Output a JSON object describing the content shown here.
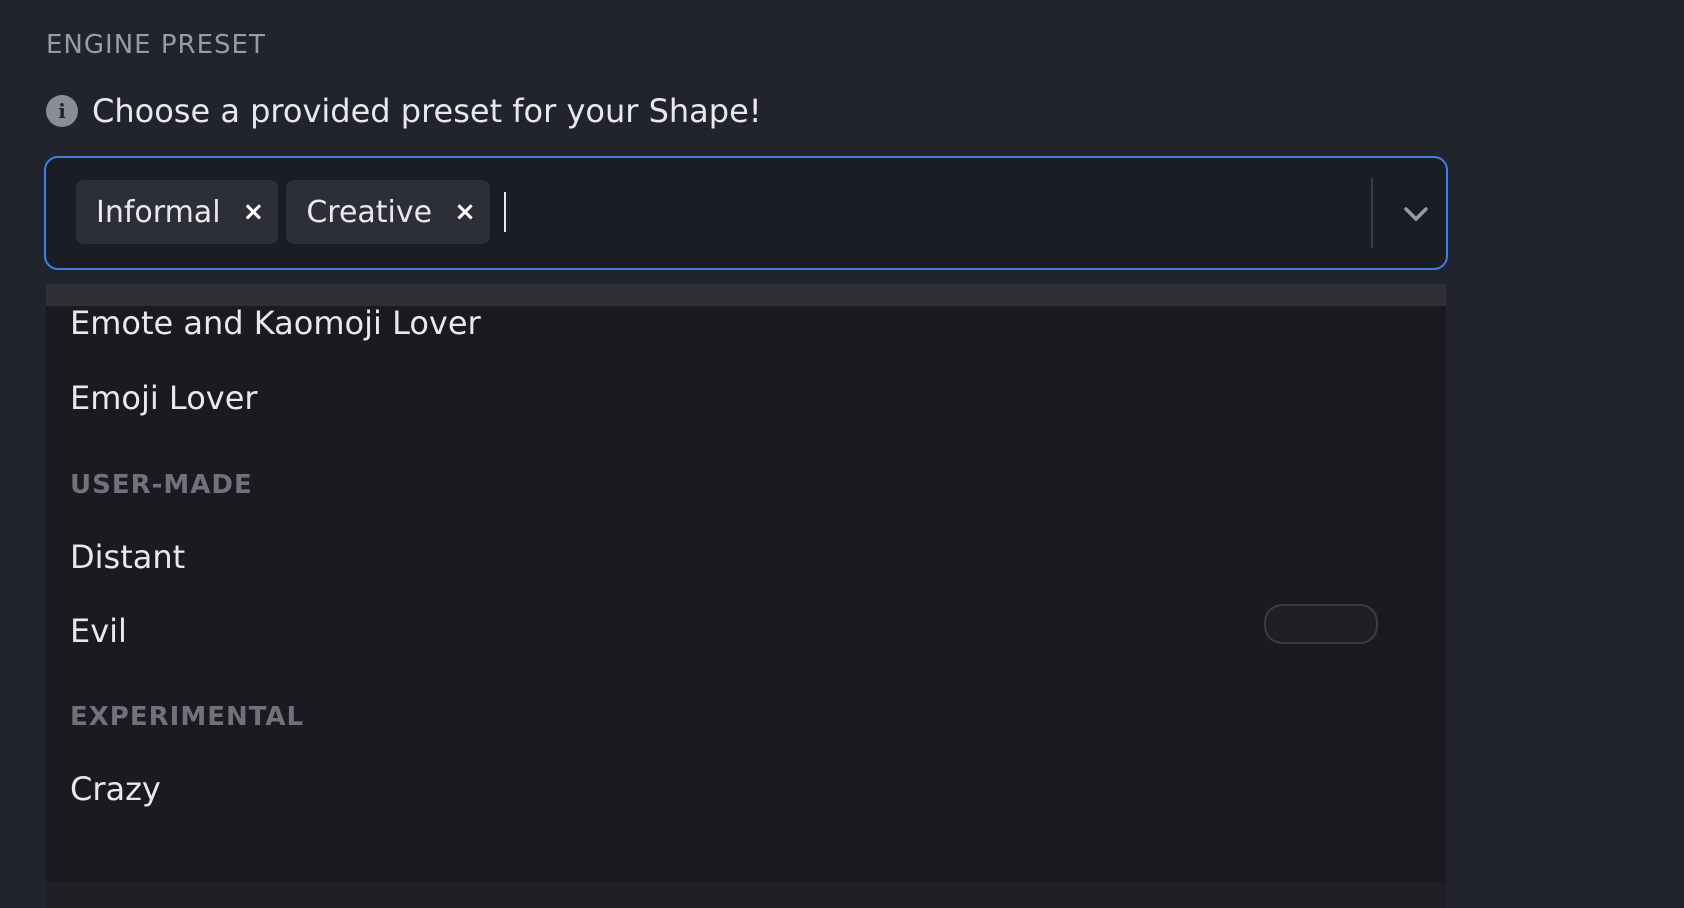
{
  "section": {
    "label": "ENGINE PRESET"
  },
  "hint": {
    "icon": "info-icon",
    "text": "Choose a provided preset for your Shape!"
  },
  "select": {
    "selected_tags": [
      {
        "label": "Informal",
        "remove_glyph": "×"
      },
      {
        "label": "Creative",
        "remove_glyph": "×"
      }
    ],
    "dropdown_icon": "chevron-down-icon",
    "accent_color": "#3f7ee8"
  },
  "menu": {
    "items": [
      {
        "label": "Emote and Kaomoji Lover"
      },
      {
        "label": "Emoji Lover"
      }
    ],
    "groups": [
      {
        "label": "USER-MADE",
        "items": [
          {
            "label": "Distant"
          },
          {
            "label": "Evil"
          }
        ]
      },
      {
        "label": "EXPERIMENTAL",
        "items": [
          {
            "label": "Crazy"
          }
        ]
      }
    ]
  }
}
